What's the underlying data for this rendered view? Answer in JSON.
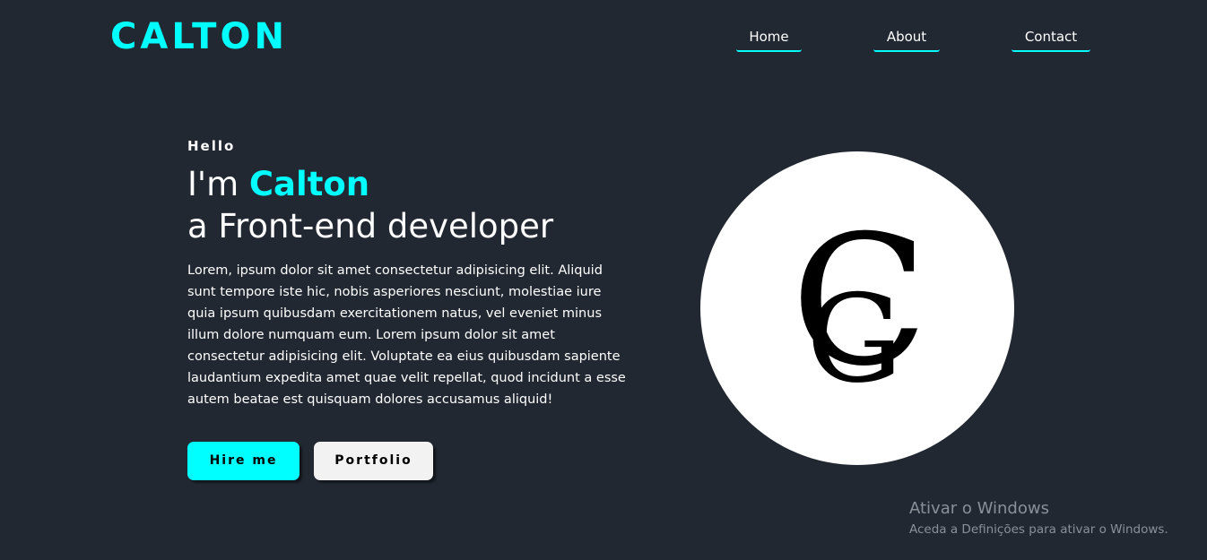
{
  "header": {
    "logo": "CALTON",
    "nav": [
      {
        "label": "Home"
      },
      {
        "label": "About"
      },
      {
        "label": "Contact"
      }
    ]
  },
  "hero": {
    "greeting": "Hello",
    "intro_prefix": "I'm ",
    "name": "Calton",
    "role": "a Front-end developer",
    "description": "Lorem, ipsum dolor sit amet consectetur adipisicing elit. Aliquid sunt tempore iste hic, nobis asperiores nesciunt, molestiae iure quia ipsum quibusdam exercitationem natus, vel eveniet minus illum dolore numquam eum. Lorem ipsum dolor sit amet consectetur adipisicing elit. Voluptate ea eius quibusdam sapiente laudantium expedita amet quae velit repellat, quod incidunt a esse autem beatae est quisquam dolores accusamus aliquid!",
    "buttons": {
      "hire": "Hire me",
      "portfolio": "Portfolio"
    }
  },
  "monogram": {
    "letter1": "C",
    "letter2": "G"
  },
  "windows_watermark": {
    "title": "Ativar o Windows",
    "subtitle": "Aceda a Definições para ativar o Windows."
  },
  "colors": {
    "background": "#212832",
    "accent": "#00ffff",
    "text": "#ffffff",
    "secondary_button": "#f2f2f2"
  }
}
